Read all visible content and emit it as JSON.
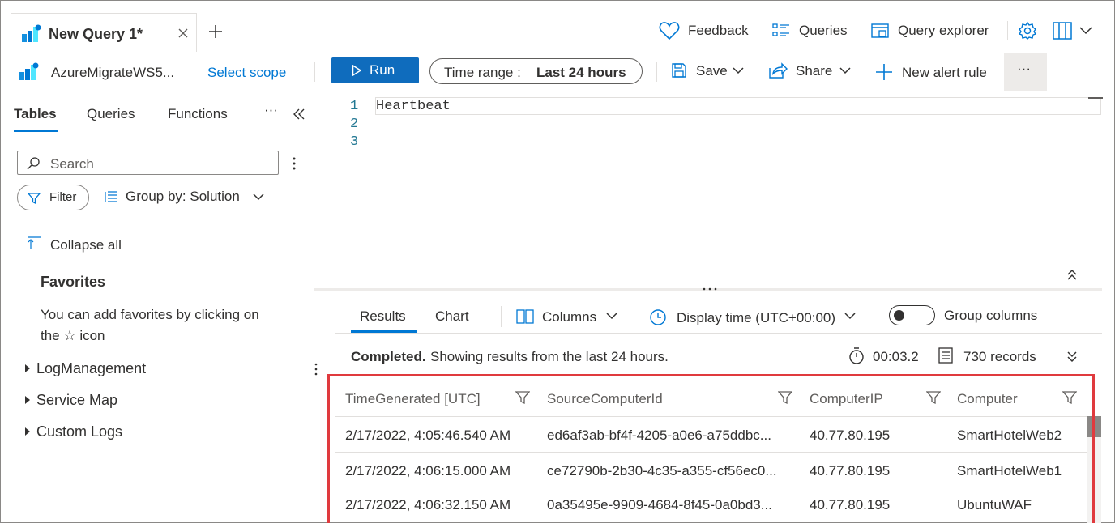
{
  "tabs": {
    "active_title": "New Query 1*",
    "add_label": "+"
  },
  "top_actions": {
    "feedback": "Feedback",
    "queries": "Queries",
    "query_explorer": "Query explorer"
  },
  "toolbar": {
    "workspace": "AzureMigrateWS5...",
    "select_scope": "Select scope",
    "run": "Run",
    "time_range_label": "Time range :",
    "time_range_value": "Last 24 hours",
    "save": "Save",
    "share": "Share",
    "new_alert_rule": "New alert rule",
    "more": "···"
  },
  "left_panel": {
    "tabs": [
      "Tables",
      "Queries",
      "Functions"
    ],
    "more": "···",
    "search_placeholder": "Search",
    "filter": "Filter",
    "group_by": "Group by: Solution",
    "collapse_all": "Collapse all",
    "favorites_title": "Favorites",
    "favorites_hint_1": "You can add favorites by clicking on",
    "favorites_hint_2": "the ☆ icon",
    "groups": [
      "LogManagement",
      "Service Map",
      "Custom Logs"
    ]
  },
  "editor": {
    "line_numbers": [
      "1",
      "2",
      "3"
    ],
    "lines": [
      "Heartbeat",
      "",
      ""
    ]
  },
  "results": {
    "tabs": [
      "Results",
      "Chart"
    ],
    "columns_btn": "Columns",
    "display_time": "Display time (UTC+00:00)",
    "group_columns": "Group columns",
    "status_bold": "Completed.",
    "status_rest": " Showing results from the last 24 hours.",
    "duration": "00:03.2",
    "records": "730 records",
    "headers": [
      "TimeGenerated [UTC]",
      "SourceComputerId",
      "ComputerIP",
      "Computer"
    ],
    "rows": [
      [
        "2/17/2022, 4:05:46.540 AM",
        "ed6af3ab-bf4f-4205-a0e6-a75ddbc...",
        "40.77.80.195",
        "SmartHotelWeb2"
      ],
      [
        "2/17/2022, 4:06:15.000 AM",
        "ce72790b-2b30-4c35-a355-cf56ec0...",
        "40.77.80.195",
        "SmartHotelWeb1"
      ],
      [
        "2/17/2022, 4:06:32.150 AM",
        "0a35495e-9909-4684-8f45-0a0bd3...",
        "40.77.80.195",
        "UbuntuWAF"
      ]
    ]
  },
  "colors": {
    "accent": "#0078d4",
    "run_button": "#0f6cbd",
    "highlight_box": "#e03a3e"
  }
}
